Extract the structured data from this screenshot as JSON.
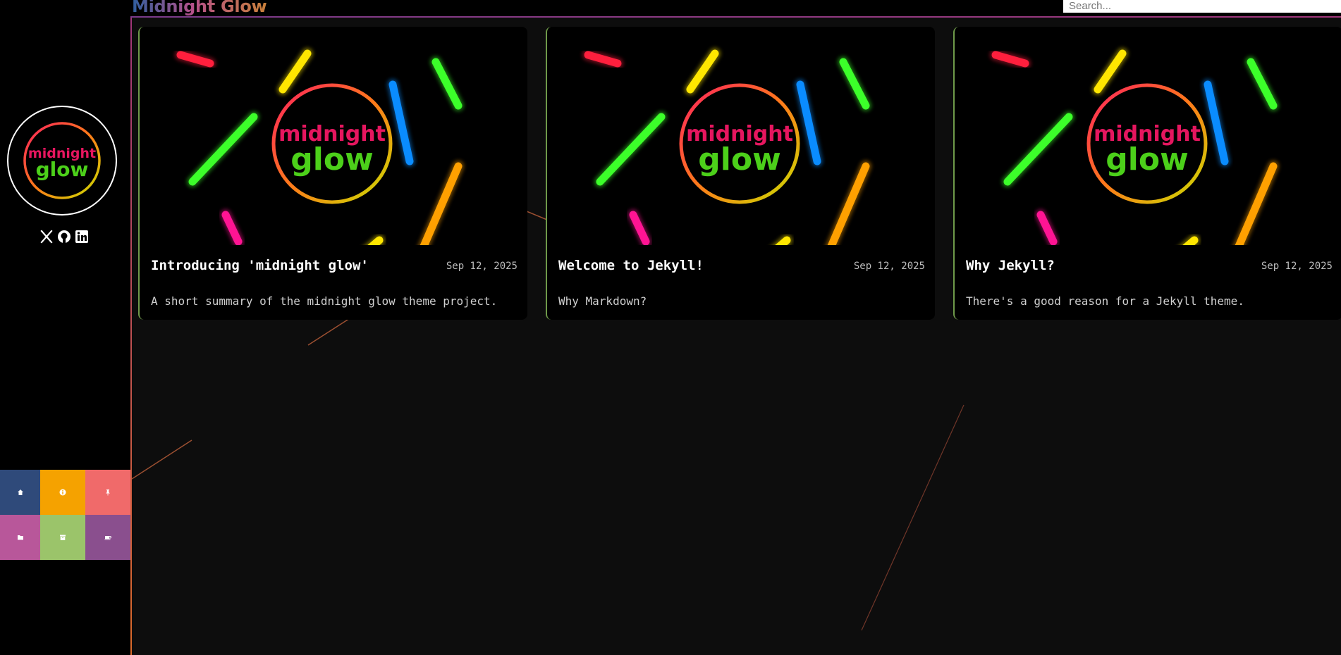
{
  "site": {
    "title": "Midnight Glow"
  },
  "search": {
    "placeholder": "Search..."
  },
  "sidebar": {
    "logo": {
      "line1": "midnight",
      "line2": "glow"
    },
    "socials": [
      "x-icon",
      "github-icon",
      "linkedin-icon"
    ],
    "tiles": [
      {
        "icon": "home-icon",
        "color": "#2f4a7a"
      },
      {
        "icon": "info-icon",
        "color": "#f5a200"
      },
      {
        "icon": "pin-icon",
        "color": "#f06a6a"
      },
      {
        "icon": "folder-icon",
        "color": "#b8579a"
      },
      {
        "icon": "archive-icon",
        "color": "#9bc46a"
      },
      {
        "icon": "coffee-icon",
        "color": "#8a4f8e"
      }
    ]
  },
  "posts": [
    {
      "title": "Introducing 'midnight glow'",
      "date": "Sep 12, 2025",
      "summary": "A short summary of the midnight glow theme project.",
      "thumb_text": [
        "midnight",
        "glow"
      ]
    },
    {
      "title": "Welcome to Jekyll!",
      "date": "Sep 12, 2025",
      "summary": "Why Markdown?",
      "thumb_text": [
        "midnight",
        "glow"
      ]
    },
    {
      "title": "Why Jekyll?",
      "date": "Sep 12, 2025",
      "summary": "There's a good reason for a Jekyll theme.",
      "thumb_text": [
        "midnight",
        "glow"
      ]
    }
  ],
  "colors": {
    "accent_magenta": "#e6165f",
    "accent_green": "#4cd01a",
    "glow_red": "#ff1f3d",
    "glow_yellow": "#ffe600",
    "glow_green": "#3cff2a",
    "glow_blue": "#0a8cff",
    "glow_orange": "#ffa000",
    "glow_pink": "#ff1493"
  }
}
